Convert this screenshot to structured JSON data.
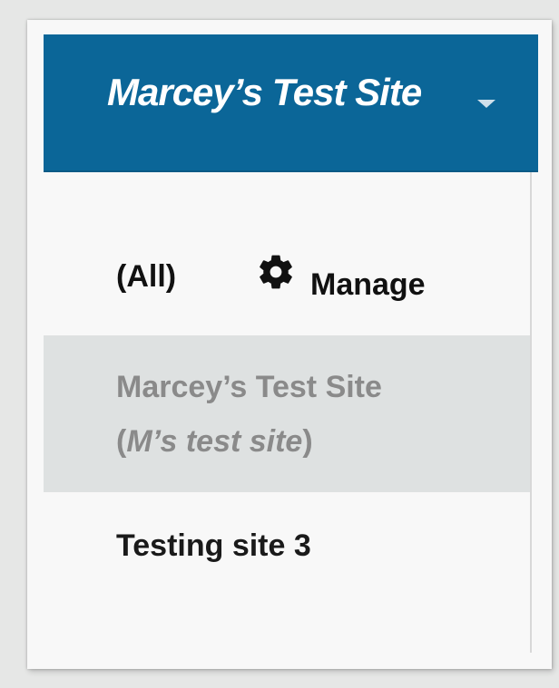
{
  "header": {
    "title": "Marcey’s Test Site",
    "dropdown_icon": "chevron-down-icon"
  },
  "menu": {
    "all_label": "(All)",
    "manage": {
      "icon": "gear-icon",
      "label": "Manage"
    },
    "sites": [
      {
        "name": "Marcey’s Test Site",
        "subtitle_open": "(",
        "subtitle_italic": "M’s test site",
        "subtitle_close": ")",
        "selected": true
      },
      {
        "name": "Testing site 3",
        "selected": false
      }
    ]
  },
  "colors": {
    "header_bg": "#0b6698",
    "menu_bg": "#f8f8f8",
    "selected_bg": "#dee1e1",
    "selected_text": "#8a8a8a",
    "text": "#111111"
  }
}
